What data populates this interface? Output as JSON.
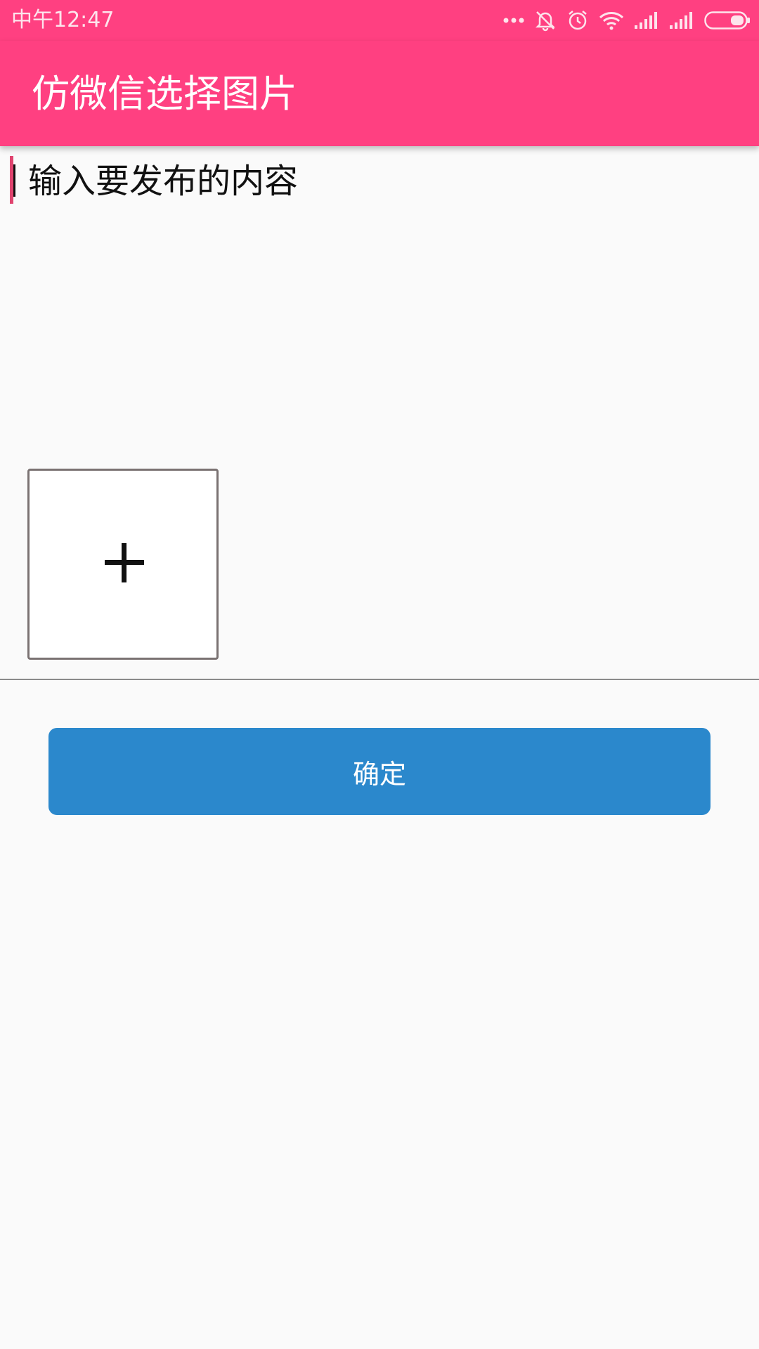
{
  "status_bar": {
    "time": "中午12:47",
    "icons": [
      "more-dots-icon",
      "muted-bell-icon",
      "alarm-clock-icon",
      "wifi-icon",
      "signal-icon",
      "signal-icon",
      "battery-icon"
    ]
  },
  "app_bar": {
    "title": "仿微信选择图片"
  },
  "content_input": {
    "placeholder": "输入要发布的内容",
    "value": ""
  },
  "photo_grid": {
    "add_tile_icon": "plus-icon"
  },
  "actions": {
    "confirm_label": "确定"
  },
  "colors": {
    "accent": "#ff4081",
    "button": "#2b88cc",
    "background": "#fafafa"
  }
}
